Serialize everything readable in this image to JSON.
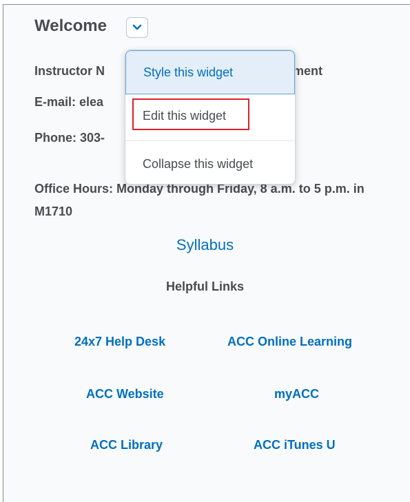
{
  "widget": {
    "title": "Welcome",
    "menu_toggle_icon": "chevron-down-icon"
  },
  "info": {
    "name_line": "Instructor N",
    "name_suffix": "ment",
    "email_line": "E-mail: elea",
    "phone_line": "Phone: 303-",
    "hours_line": "Office Hours: Monday through Friday, 8 a.m. to 5 p.m. in M1710"
  },
  "syllabus": "Syllabus",
  "helpful_links": {
    "heading": "Helpful Links",
    "links": [
      "24x7 Help Desk",
      "ACC Online Learning",
      "ACC Website",
      "myACC",
      "ACC Library",
      "ACC iTunes U"
    ]
  },
  "dropdown": {
    "items": [
      "Style this widget",
      "Edit this widget",
      "Collapse this widget"
    ]
  },
  "colors": {
    "link": "#006fbf",
    "text": "#494c4e",
    "highlight": "#d9202c"
  }
}
